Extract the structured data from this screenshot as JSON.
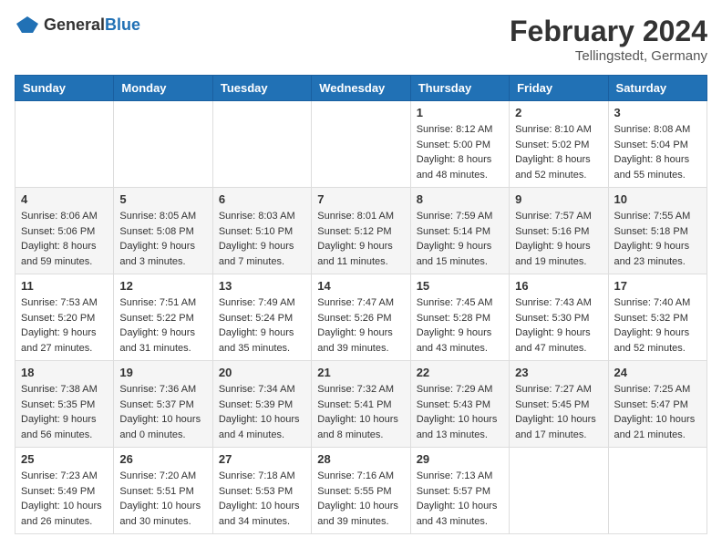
{
  "header": {
    "logo_general": "General",
    "logo_blue": "Blue",
    "month_year": "February 2024",
    "location": "Tellingstedt, Germany"
  },
  "weekdays": [
    "Sunday",
    "Monday",
    "Tuesday",
    "Wednesday",
    "Thursday",
    "Friday",
    "Saturday"
  ],
  "weeks": [
    [
      {
        "day": "",
        "info": ""
      },
      {
        "day": "",
        "info": ""
      },
      {
        "day": "",
        "info": ""
      },
      {
        "day": "",
        "info": ""
      },
      {
        "day": "1",
        "info": "Sunrise: 8:12 AM\nSunset: 5:00 PM\nDaylight: 8 hours\nand 48 minutes."
      },
      {
        "day": "2",
        "info": "Sunrise: 8:10 AM\nSunset: 5:02 PM\nDaylight: 8 hours\nand 52 minutes."
      },
      {
        "day": "3",
        "info": "Sunrise: 8:08 AM\nSunset: 5:04 PM\nDaylight: 8 hours\nand 55 minutes."
      }
    ],
    [
      {
        "day": "4",
        "info": "Sunrise: 8:06 AM\nSunset: 5:06 PM\nDaylight: 8 hours\nand 59 minutes."
      },
      {
        "day": "5",
        "info": "Sunrise: 8:05 AM\nSunset: 5:08 PM\nDaylight: 9 hours\nand 3 minutes."
      },
      {
        "day": "6",
        "info": "Sunrise: 8:03 AM\nSunset: 5:10 PM\nDaylight: 9 hours\nand 7 minutes."
      },
      {
        "day": "7",
        "info": "Sunrise: 8:01 AM\nSunset: 5:12 PM\nDaylight: 9 hours\nand 11 minutes."
      },
      {
        "day": "8",
        "info": "Sunrise: 7:59 AM\nSunset: 5:14 PM\nDaylight: 9 hours\nand 15 minutes."
      },
      {
        "day": "9",
        "info": "Sunrise: 7:57 AM\nSunset: 5:16 PM\nDaylight: 9 hours\nand 19 minutes."
      },
      {
        "day": "10",
        "info": "Sunrise: 7:55 AM\nSunset: 5:18 PM\nDaylight: 9 hours\nand 23 minutes."
      }
    ],
    [
      {
        "day": "11",
        "info": "Sunrise: 7:53 AM\nSunset: 5:20 PM\nDaylight: 9 hours\nand 27 minutes."
      },
      {
        "day": "12",
        "info": "Sunrise: 7:51 AM\nSunset: 5:22 PM\nDaylight: 9 hours\nand 31 minutes."
      },
      {
        "day": "13",
        "info": "Sunrise: 7:49 AM\nSunset: 5:24 PM\nDaylight: 9 hours\nand 35 minutes."
      },
      {
        "day": "14",
        "info": "Sunrise: 7:47 AM\nSunset: 5:26 PM\nDaylight: 9 hours\nand 39 minutes."
      },
      {
        "day": "15",
        "info": "Sunrise: 7:45 AM\nSunset: 5:28 PM\nDaylight: 9 hours\nand 43 minutes."
      },
      {
        "day": "16",
        "info": "Sunrise: 7:43 AM\nSunset: 5:30 PM\nDaylight: 9 hours\nand 47 minutes."
      },
      {
        "day": "17",
        "info": "Sunrise: 7:40 AM\nSunset: 5:32 PM\nDaylight: 9 hours\nand 52 minutes."
      }
    ],
    [
      {
        "day": "18",
        "info": "Sunrise: 7:38 AM\nSunset: 5:35 PM\nDaylight: 9 hours\nand 56 minutes."
      },
      {
        "day": "19",
        "info": "Sunrise: 7:36 AM\nSunset: 5:37 PM\nDaylight: 10 hours\nand 0 minutes."
      },
      {
        "day": "20",
        "info": "Sunrise: 7:34 AM\nSunset: 5:39 PM\nDaylight: 10 hours\nand 4 minutes."
      },
      {
        "day": "21",
        "info": "Sunrise: 7:32 AM\nSunset: 5:41 PM\nDaylight: 10 hours\nand 8 minutes."
      },
      {
        "day": "22",
        "info": "Sunrise: 7:29 AM\nSunset: 5:43 PM\nDaylight: 10 hours\nand 13 minutes."
      },
      {
        "day": "23",
        "info": "Sunrise: 7:27 AM\nSunset: 5:45 PM\nDaylight: 10 hours\nand 17 minutes."
      },
      {
        "day": "24",
        "info": "Sunrise: 7:25 AM\nSunset: 5:47 PM\nDaylight: 10 hours\nand 21 minutes."
      }
    ],
    [
      {
        "day": "25",
        "info": "Sunrise: 7:23 AM\nSunset: 5:49 PM\nDaylight: 10 hours\nand 26 minutes."
      },
      {
        "day": "26",
        "info": "Sunrise: 7:20 AM\nSunset: 5:51 PM\nDaylight: 10 hours\nand 30 minutes."
      },
      {
        "day": "27",
        "info": "Sunrise: 7:18 AM\nSunset: 5:53 PM\nDaylight: 10 hours\nand 34 minutes."
      },
      {
        "day": "28",
        "info": "Sunrise: 7:16 AM\nSunset: 5:55 PM\nDaylight: 10 hours\nand 39 minutes."
      },
      {
        "day": "29",
        "info": "Sunrise: 7:13 AM\nSunset: 5:57 PM\nDaylight: 10 hours\nand 43 minutes."
      },
      {
        "day": "",
        "info": ""
      },
      {
        "day": "",
        "info": ""
      }
    ]
  ]
}
